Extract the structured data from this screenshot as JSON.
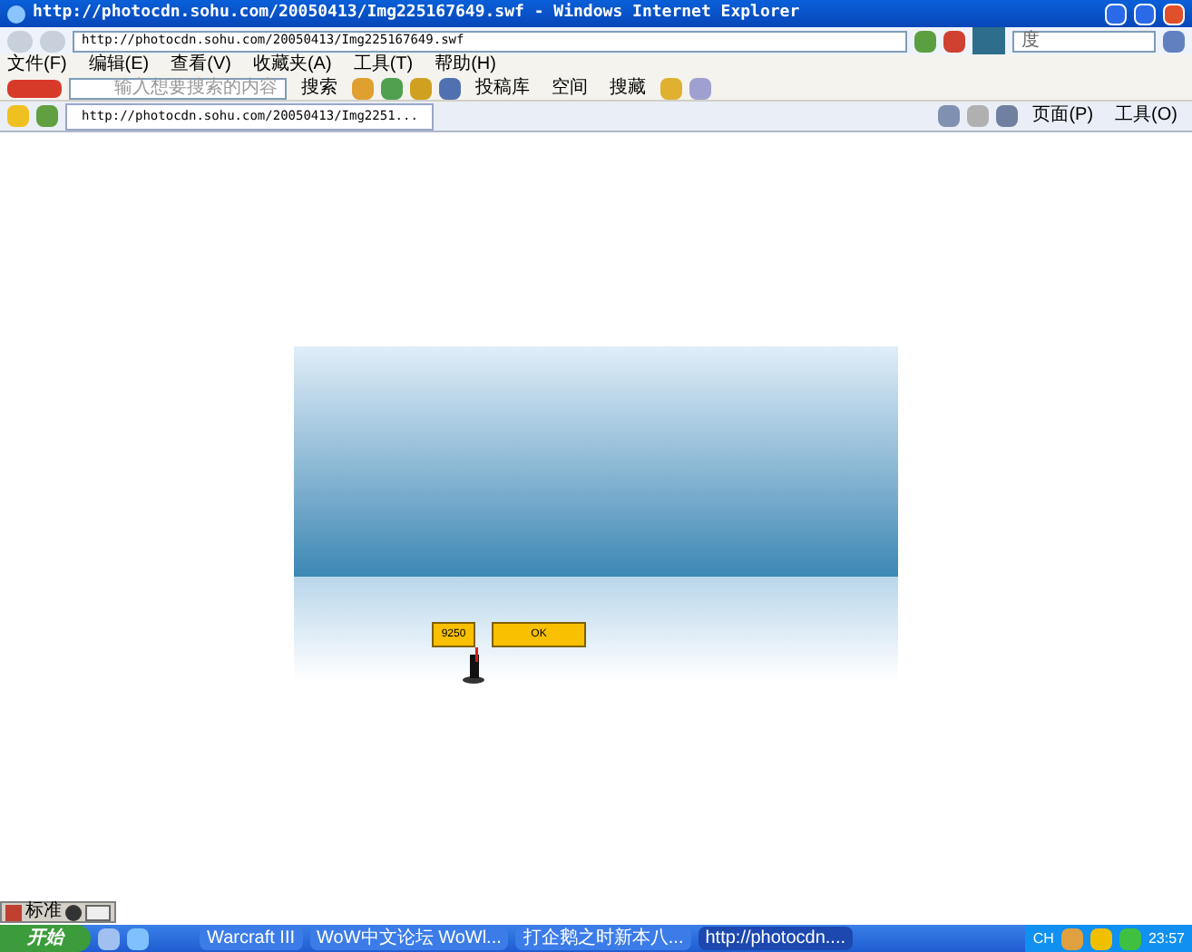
{
  "window": {
    "title": "http://photocdn.sohu.com/20050413/Img225167649.swf - Windows Internet Explorer"
  },
  "address_bar": {
    "url": "http://photocdn.sohu.com/20050413/Img225167649.swf",
    "search_value": "度"
  },
  "menu": [
    "文件(F)",
    "编辑(E)",
    "查看(V)",
    "收藏夹(A)",
    "工具(T)",
    "帮助(H)"
  ],
  "baidu_toolbar": {
    "placeholder": "输入想要搜索的内容",
    "search": "搜索",
    "buttons": [
      "投稿库",
      "空间",
      "搜藏"
    ]
  },
  "tab": {
    "label": "http://photocdn.sohu.com/20050413/Img2251...",
    "selected": true
  },
  "command_bar": [
    "页面(P)",
    "工具(O)"
  ],
  "flash": {
    "score": "9250",
    "ok": "OK"
  },
  "ime_bar": {
    "mode": "标准"
  },
  "taskbar": {
    "start": "开始",
    "tasks": [
      {
        "label": "Warcraft III",
        "selected": false
      },
      {
        "label": "WoW中文论坛 WoWl...",
        "selected": false
      },
      {
        "label": "打企鹅之时新本八...",
        "selected": false
      },
      {
        "label": "http://photocdn....",
        "selected": true
      }
    ],
    "lang": "CH",
    "clock": "23:57"
  }
}
